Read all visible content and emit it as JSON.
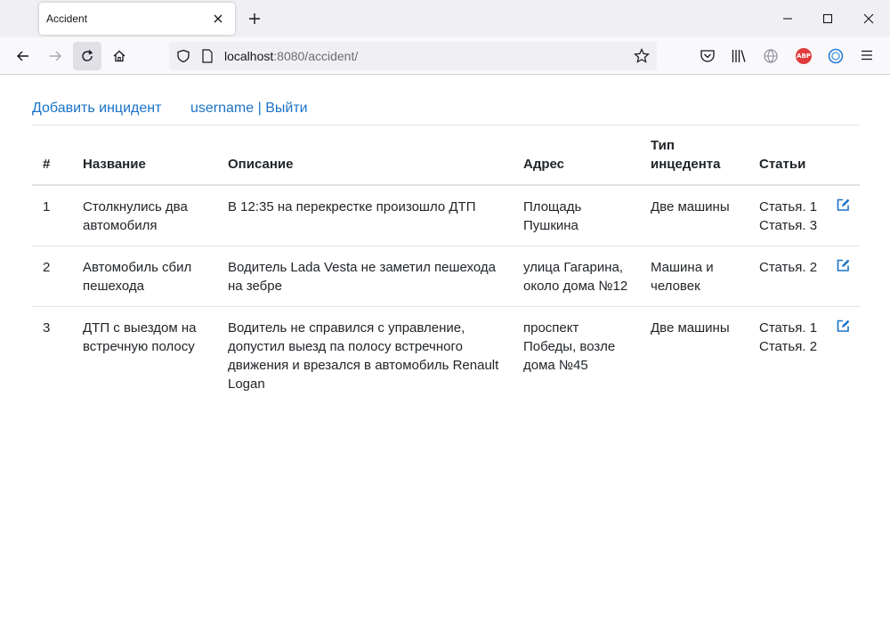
{
  "browser": {
    "tab_title": "Accident",
    "url_host": "localhost",
    "url_rest": ":8080/accident/",
    "icons": [
      "close-icon",
      "plus-icon",
      "minimize-icon",
      "maximize-icon",
      "window-close-icon",
      "back-icon",
      "forward-icon",
      "reload-icon",
      "home-icon",
      "shield-icon",
      "page-icon",
      "star-icon",
      "pocket-icon",
      "library-icon",
      "globe-icon",
      "adblock-icon",
      "extension-icon",
      "menu-icon"
    ],
    "adblock_label": "ABP"
  },
  "page": {
    "add_link": "Добавить инцидент",
    "username": "username",
    "separator": "|",
    "logout": "Выйти",
    "link_color": "#1a73c7"
  },
  "table": {
    "headers": {
      "num": "#",
      "name": "Название",
      "description": "Описание",
      "address": "Адрес",
      "type": "Тип инцедента",
      "articles": "Статьи"
    },
    "rows": [
      {
        "num": "1",
        "name": "Столкнулись два автомобиля",
        "description": "В 12:35 на перекрестке произошло ДТП",
        "address": "Площадь Пушкина",
        "type": "Две машины",
        "articles": [
          "Статья. 1",
          "Статья. 3"
        ]
      },
      {
        "num": "2",
        "name": "Автомобиль сбил пешехода",
        "description": "Водитель Lada Vesta не заметил пешехода на зебре",
        "address": "улица Гагарина, около дома №12",
        "type": "Машина и человек",
        "articles": [
          "Статья. 2"
        ]
      },
      {
        "num": "3",
        "name": "ДТП с выездом на встречную полосу",
        "description": "Водитель не справился с управление, допустил выезд па полосу встречного движения и врезался в автомобиль Renault Logan",
        "address": "проспект Победы, возле дома №45",
        "type": "Две машины",
        "articles": [
          "Статья. 1",
          "Статья. 2"
        ]
      }
    ]
  }
}
